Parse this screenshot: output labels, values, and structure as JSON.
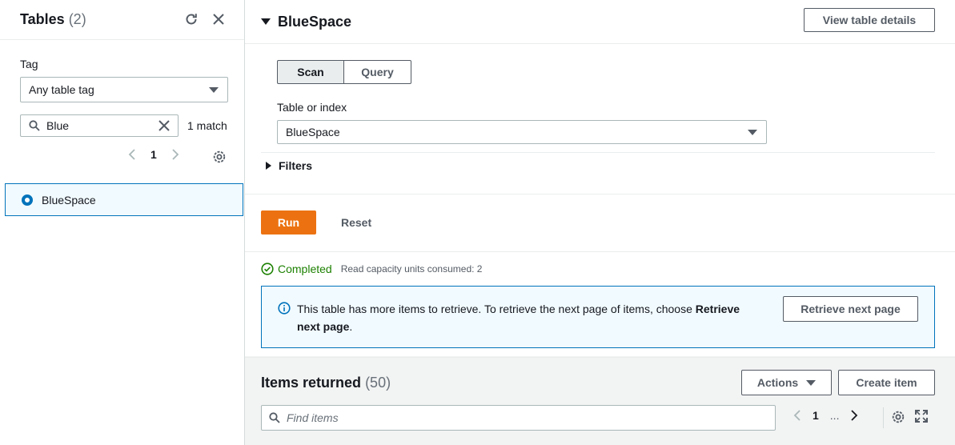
{
  "left": {
    "title": "Tables",
    "count": "(2)",
    "tag_label": "Tag",
    "tag_select_value": "Any table tag",
    "search_value": "Blue",
    "match_text": "1 match",
    "page_number": "1",
    "tables": [
      {
        "name": "BlueSpace",
        "selected": true
      }
    ]
  },
  "main": {
    "title": "BlueSpace",
    "view_details_label": "View table details",
    "tabs": [
      {
        "label": "Scan",
        "active": true
      },
      {
        "label": "Query",
        "active": false
      }
    ],
    "table_or_index_label": "Table or index",
    "table_or_index_value": "BlueSpace",
    "filters_label": "Filters",
    "run_label": "Run",
    "reset_label": "Reset",
    "status_text": "Completed",
    "capacity_text": "Read capacity units consumed: 2",
    "info": {
      "message_prefix": "This table has more items to retrieve. To retrieve the next page of items, choose ",
      "message_bold": "Retrieve next page",
      "message_suffix": ".",
      "button_label": "Retrieve next page"
    },
    "items": {
      "title": "Items returned",
      "count": "(50)",
      "actions_label": "Actions",
      "create_label": "Create item",
      "find_placeholder": "Find items",
      "page_number": "1",
      "ellipsis": "..."
    }
  },
  "colors": {
    "accent_blue": "#0073bb",
    "run_orange": "#ec7211",
    "success_green": "#1d8102"
  }
}
